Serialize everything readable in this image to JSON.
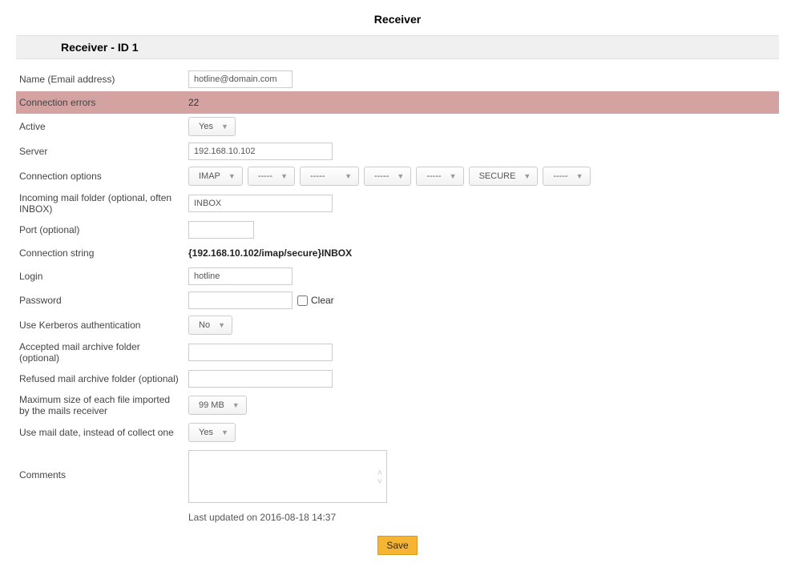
{
  "page_title": "Receiver",
  "panel_title": "Receiver - ID 1",
  "labels": {
    "name": "Name (Email address)",
    "connection_errors": "Connection errors",
    "active": "Active",
    "server": "Server",
    "connection_options": "Connection options",
    "incoming_folder": "Incoming mail folder (optional, often INBOX)",
    "port": "Port (optional)",
    "connection_string": "Connection string",
    "login": "Login",
    "password": "Password",
    "clear": "Clear",
    "kerberos": "Use Kerberos authentication",
    "accepted_folder": "Accepted mail archive folder (optional)",
    "refused_folder": "Refused mail archive folder (optional)",
    "max_size": "Maximum size of each file imported by the mails receiver",
    "use_mail_date": "Use mail date, instead of collect one",
    "comments": "Comments"
  },
  "values": {
    "name": "hotline@domain.com",
    "connection_errors": "22",
    "active": "Yes",
    "server": "192.168.10.102",
    "conn_opts": [
      "IMAP",
      "-----",
      "-----",
      "-----",
      "-----",
      "SECURE",
      "-----"
    ],
    "incoming_folder": "INBOX",
    "port": "",
    "connection_string": "{192.168.10.102/imap/secure}INBOX",
    "login": "hotline",
    "password": "",
    "kerberos": "No",
    "accepted_folder": "",
    "refused_folder": "",
    "max_size": "99 MB",
    "use_mail_date": "Yes",
    "comments": ""
  },
  "last_updated": "Last updated on 2016-08-18 14:37",
  "save_label": "Save"
}
